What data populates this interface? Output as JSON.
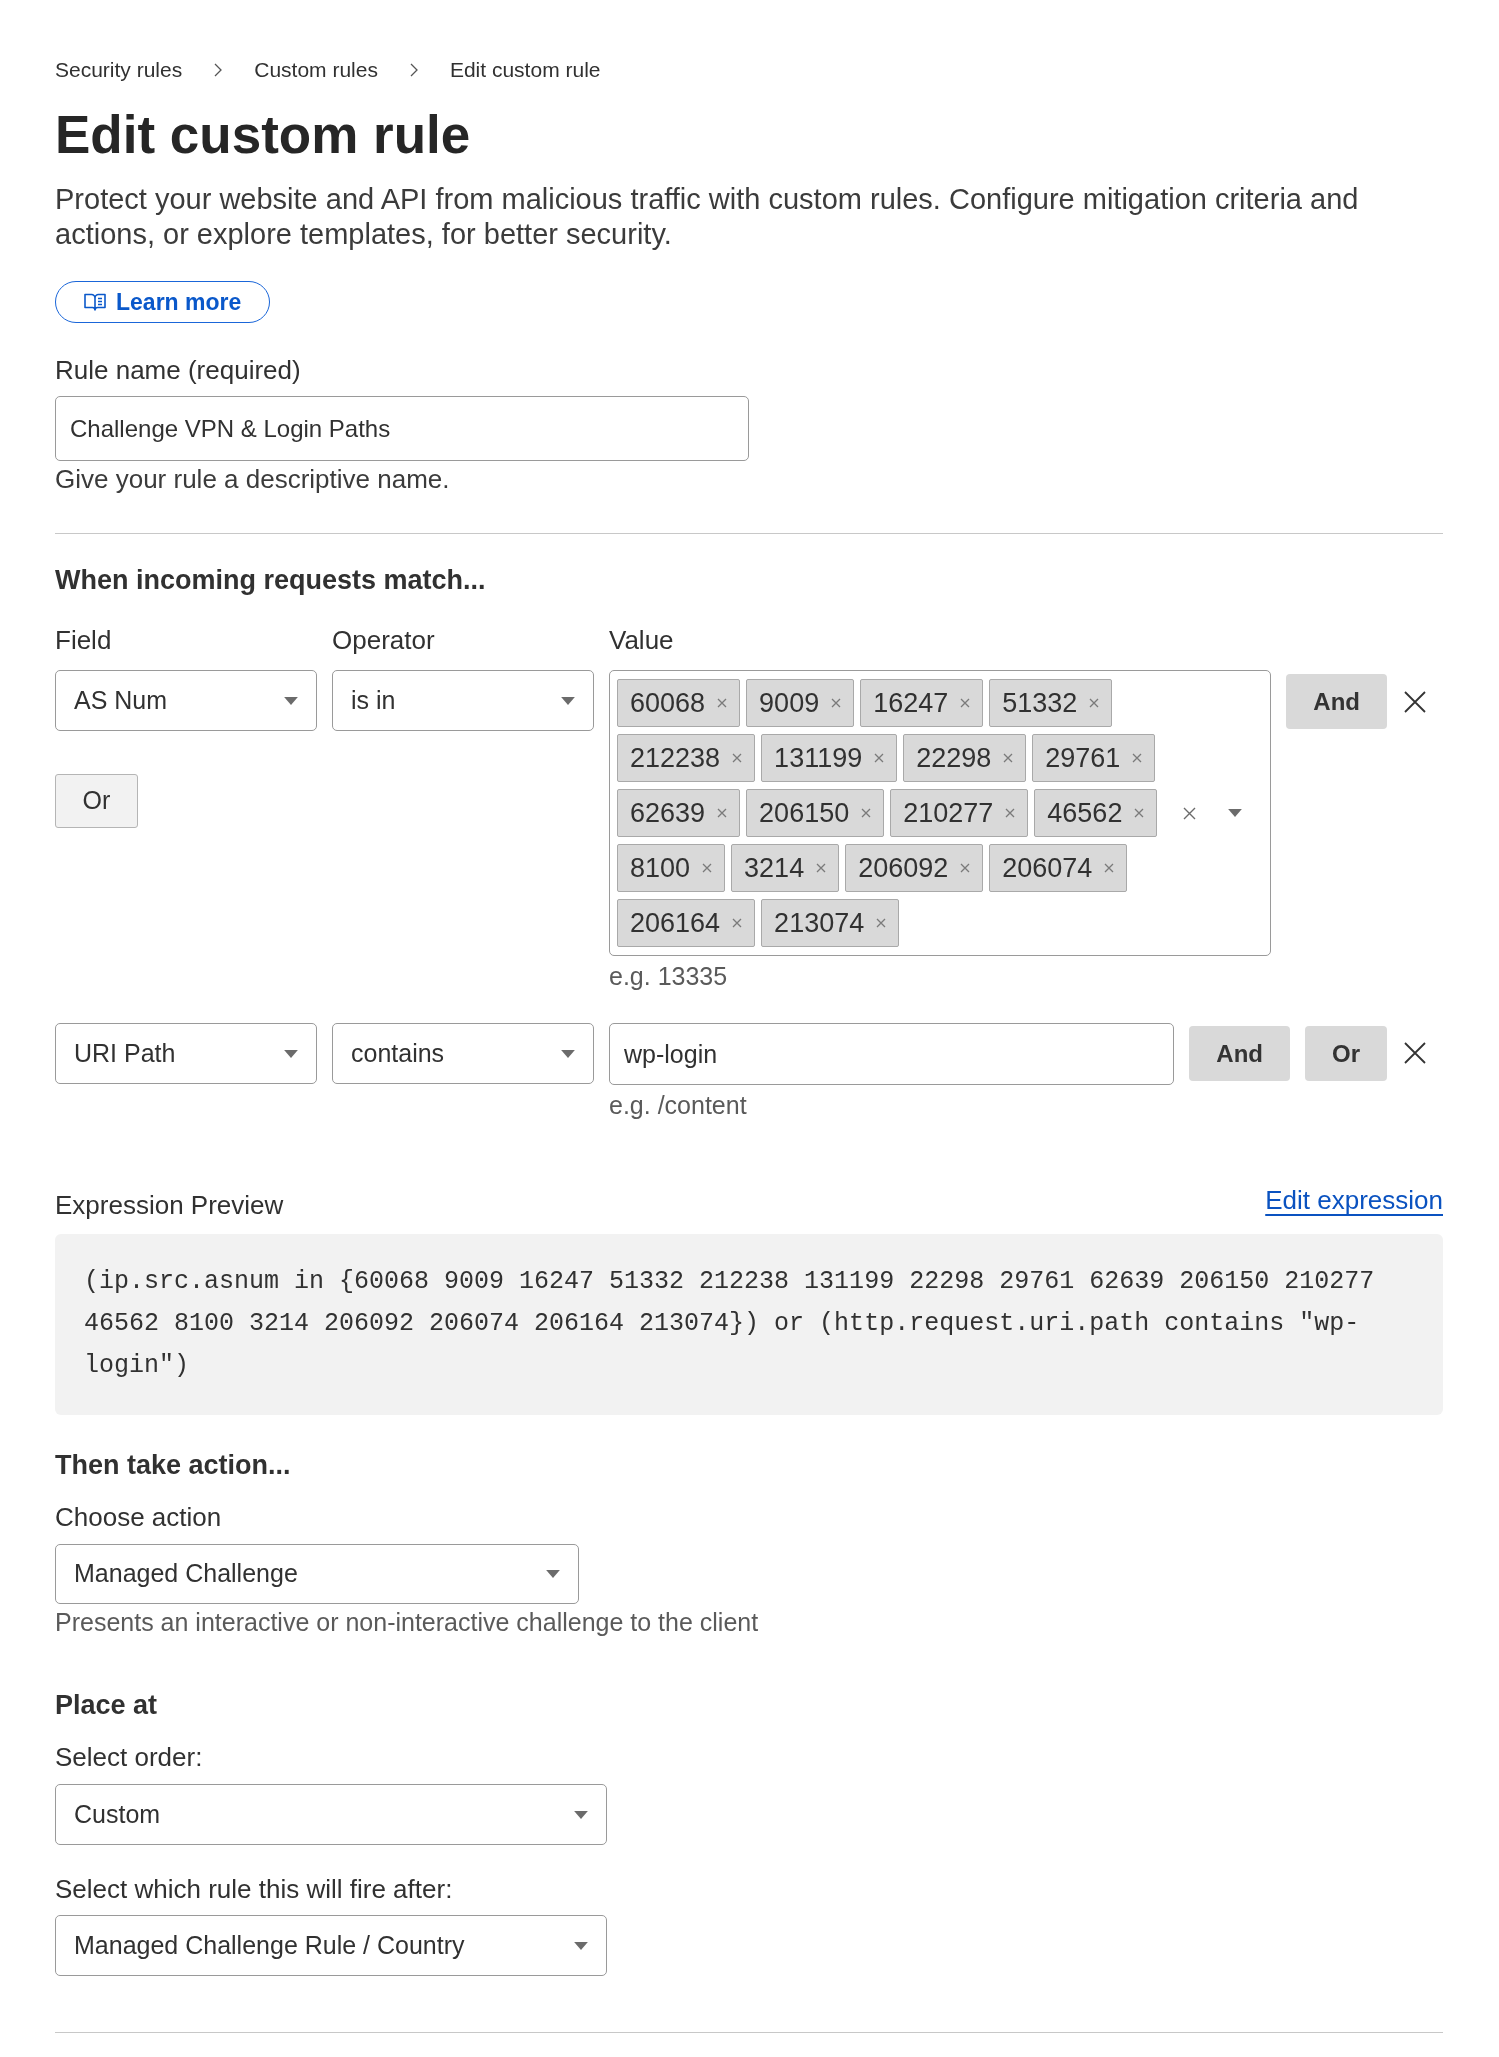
{
  "breadcrumbs": [
    {
      "label": "Security rules"
    },
    {
      "label": "Custom rules"
    },
    {
      "label": "Edit custom rule"
    }
  ],
  "page": {
    "title": "Edit custom rule",
    "description": "Protect your website and API from malicious traffic with custom rules. Configure mitigation criteria and actions, or explore templates, for better security.",
    "learn_more_button": "Learn more"
  },
  "rule_name": {
    "label": "Rule name (required)",
    "value": "Challenge VPN & Login Paths",
    "help": "Give your rule a descriptive name."
  },
  "match": {
    "heading": "When incoming requests match...",
    "column_labels": [
      "Field",
      "Operator",
      "Value"
    ],
    "conditions": [
      {
        "kind": "tags",
        "field": "AS Num",
        "operator": "is in",
        "values": [
          "60068",
          "9009",
          "16247",
          "51332",
          "212238",
          "131199",
          "22298",
          "29761",
          "62639",
          "206150",
          "210277",
          "46562",
          "8100",
          "3214",
          "206092",
          "206074",
          "206164",
          "213074"
        ],
        "hint": "e.g. 13335",
        "buttons": [
          "And"
        ]
      },
      {
        "kind": "text",
        "field": "URI Path",
        "operator": "contains",
        "value": "wp-login",
        "hint": "e.g. /content",
        "buttons": [
          "And",
          "Or"
        ]
      }
    ],
    "or_button": "Or"
  },
  "expression": {
    "label": "Expression Preview",
    "edit_link": "Edit expression",
    "code": "(ip.src.asnum in {60068 9009 16247 51332 212238 131199 22298 29761 62639 206150 210277 46562 8100 3214 206092 206074 206164 213074}) or (http.request.uri.path contains \"wp-login\")"
  },
  "action": {
    "heading": "Then take action...",
    "label": "Choose action",
    "value": "Managed Challenge",
    "help": "Presents an interactive or non-interactive challenge to the client"
  },
  "placement": {
    "heading": "Place at",
    "fields": [
      {
        "label": "Select order:",
        "value": "Custom"
      },
      {
        "label": "Select which rule this will fire after:",
        "value": "Managed Challenge Rule / Country"
      }
    ]
  }
}
